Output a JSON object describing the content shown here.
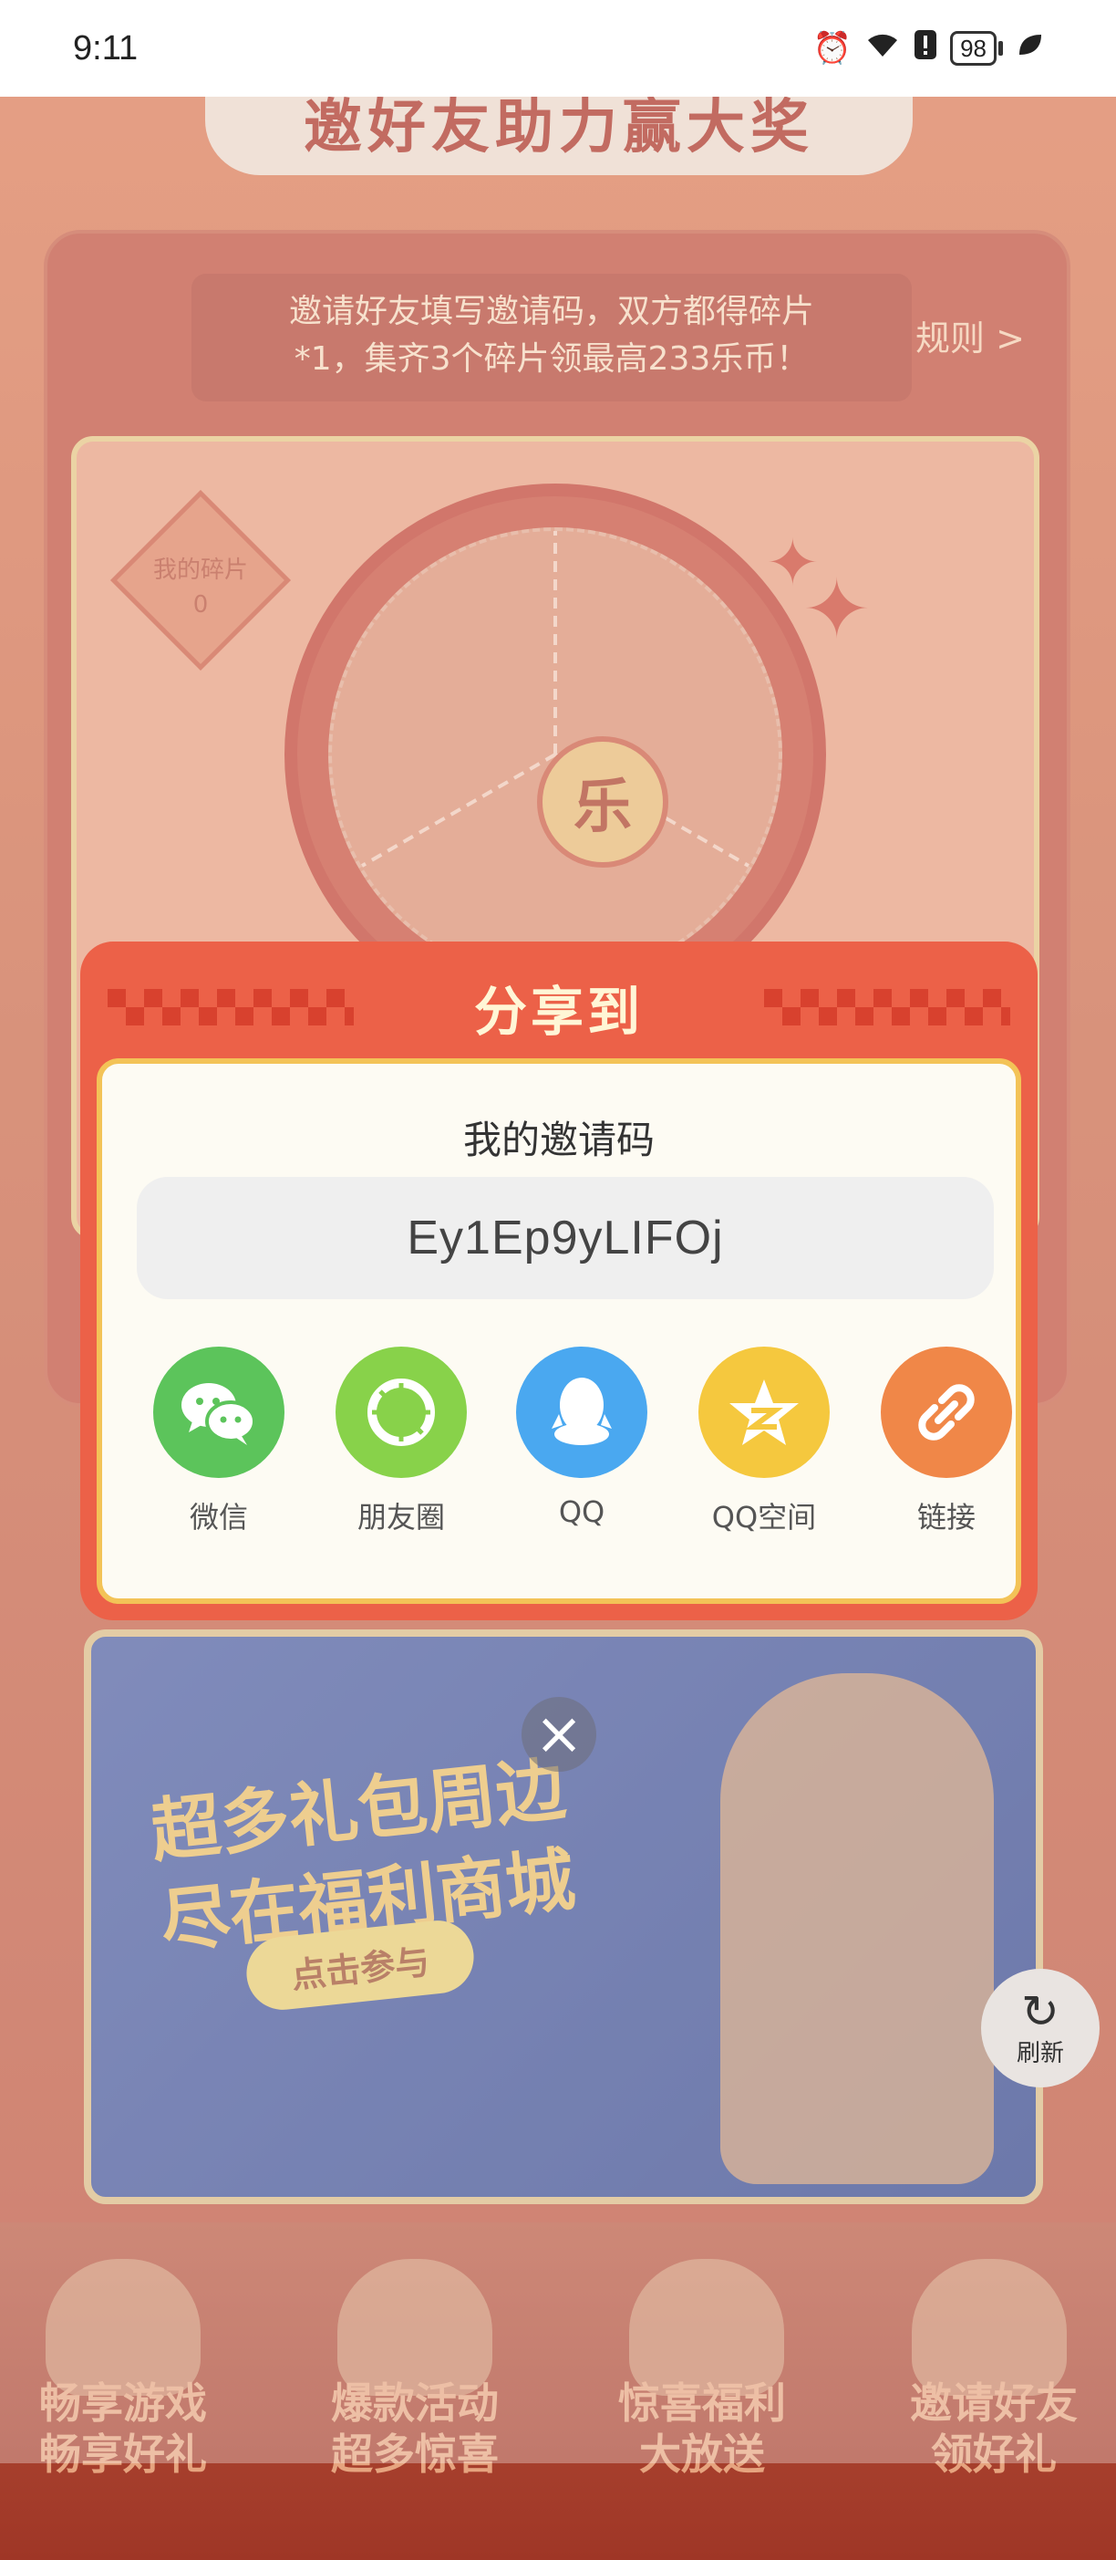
{
  "status_bar": {
    "time": "9:11",
    "battery": "98"
  },
  "background": {
    "banner_title": "邀好友助力赢大奖",
    "notice_line1": "邀请好友填写邀请码，双方都得碎片",
    "notice_line2": "*1，集齐3个碎片领最高233乐币！",
    "rules_link": "规则 >",
    "fragments_label": "我的碎片",
    "fragments_count": "0",
    "wheel_center": "乐",
    "mall_title_line1": "超多礼包周边",
    "mall_title_line2": "尽在福利商城",
    "mall_button": "点击参与",
    "refresh_label": "刷新",
    "nav": [
      {
        "line1": "畅享游戏",
        "line2": "畅享好礼"
      },
      {
        "line1": "爆款活动",
        "line2": "超多惊喜"
      },
      {
        "line1": "惊喜福利",
        "line2": "大放送"
      },
      {
        "line1": "邀请好友",
        "line2": "领好礼"
      }
    ]
  },
  "dialog": {
    "title": "分享到",
    "code_label": "我的邀请码",
    "invite_code": "Ey1Ep9yLIFOj",
    "share_targets": [
      {
        "label": "微信",
        "icon": "wechat-icon",
        "color": "#5cc45b"
      },
      {
        "label": "朋友圈",
        "icon": "moments-icon",
        "color": "#88d24a"
      },
      {
        "label": "QQ",
        "icon": "qq-icon",
        "color": "#4aa8f0"
      },
      {
        "label": "QQ空间",
        "icon": "qzone-icon",
        "color": "#f5c83e"
      },
      {
        "label": "链接",
        "icon": "link-icon",
        "color": "#f08748"
      }
    ],
    "close_icon": "close-icon"
  }
}
